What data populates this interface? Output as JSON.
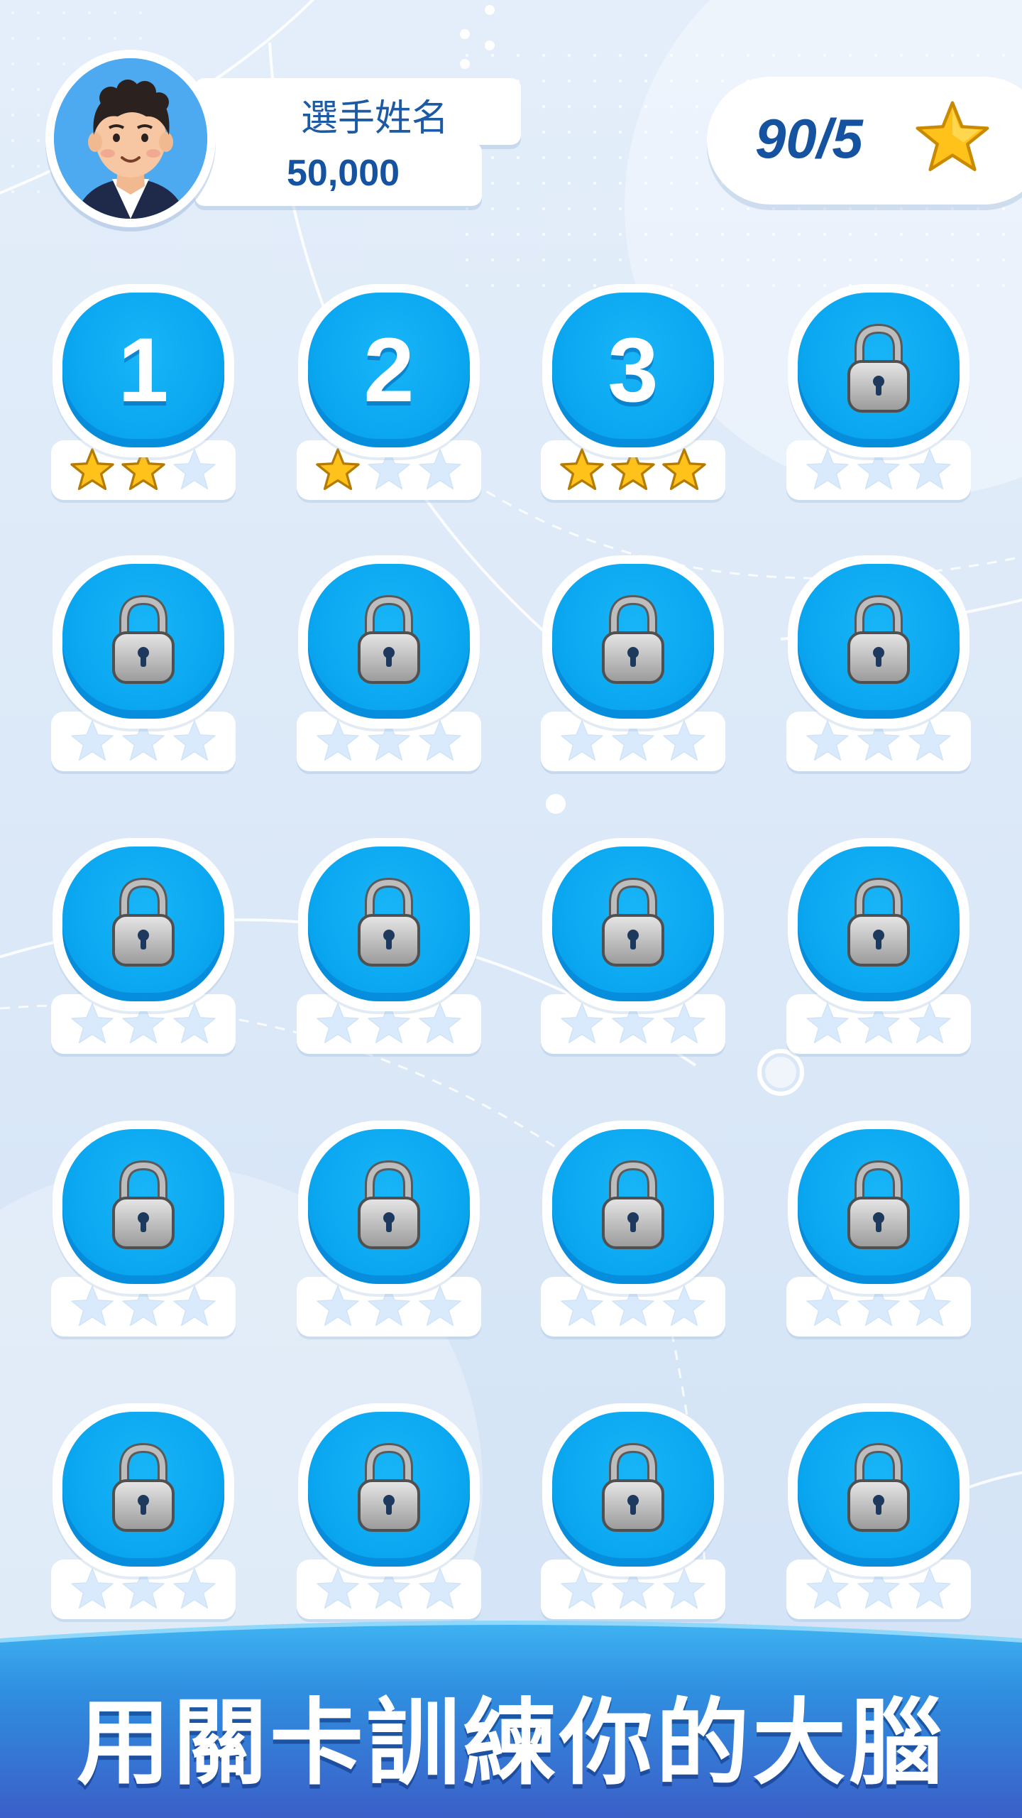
{
  "player": {
    "name": "選手姓名",
    "score": "50,000"
  },
  "stars_total": "90/5",
  "levels": [
    {
      "label": "1",
      "locked": false,
      "stars": 2
    },
    {
      "label": "2",
      "locked": false,
      "stars": 1
    },
    {
      "label": "3",
      "locked": false,
      "stars": 3
    },
    {
      "label": "",
      "locked": true,
      "stars": 0
    },
    {
      "label": "",
      "locked": true,
      "stars": 0
    },
    {
      "label": "",
      "locked": true,
      "stars": 0
    },
    {
      "label": "",
      "locked": true,
      "stars": 0
    },
    {
      "label": "",
      "locked": true,
      "stars": 0
    },
    {
      "label": "",
      "locked": true,
      "stars": 0
    },
    {
      "label": "",
      "locked": true,
      "stars": 0
    },
    {
      "label": "",
      "locked": true,
      "stars": 0
    },
    {
      "label": "",
      "locked": true,
      "stars": 0
    },
    {
      "label": "",
      "locked": true,
      "stars": 0
    },
    {
      "label": "",
      "locked": true,
      "stars": 0
    },
    {
      "label": "",
      "locked": true,
      "stars": 0
    },
    {
      "label": "",
      "locked": true,
      "stars": 0
    },
    {
      "label": "",
      "locked": true,
      "stars": 0
    },
    {
      "label": "",
      "locked": true,
      "stars": 0
    },
    {
      "label": "",
      "locked": true,
      "stars": 0
    },
    {
      "label": "",
      "locked": true,
      "stars": 0
    }
  ],
  "footer": {
    "caption": "用關卡訓練你的大腦"
  },
  "colors": {
    "tile": "#0aa6f0",
    "star_filled": "#ffc21a",
    "star_empty": "#d8eafb",
    "text_dark_blue": "#1553a0"
  },
  "icons": {
    "lock": "lock-icon",
    "star": "star-icon",
    "avatar": "player-avatar"
  }
}
